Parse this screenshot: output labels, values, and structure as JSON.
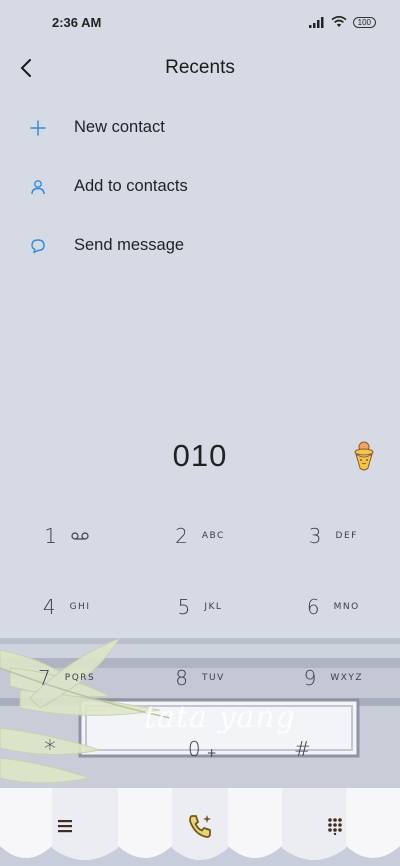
{
  "status": {
    "time": "2:36 AM",
    "battery": "100",
    "icons": [
      "signal-icon",
      "wifi-icon",
      "battery-icon"
    ]
  },
  "header": {
    "title": "Recents",
    "back_icon": "chevron-left-icon"
  },
  "actions": [
    {
      "label": "New contact",
      "icon": "plus-icon"
    },
    {
      "label": "Add to contacts",
      "icon": "person-icon"
    },
    {
      "label": "Send message",
      "icon": "chat-bubble-icon"
    }
  ],
  "dialer": {
    "number": "010",
    "sticker": "ice-cream-sticker"
  },
  "keypad": [
    [
      {
        "digit": "1",
        "letters": "voicemail"
      },
      {
        "digit": "2",
        "letters": "ABC"
      },
      {
        "digit": "3",
        "letters": "DEF"
      }
    ],
    [
      {
        "digit": "4",
        "letters": "GHI"
      },
      {
        "digit": "5",
        "letters": "JKL"
      },
      {
        "digit": "6",
        "letters": "MNO"
      }
    ],
    [
      {
        "digit": "7",
        "letters": "PQRS"
      },
      {
        "digit": "8",
        "letters": "TUV"
      },
      {
        "digit": "9",
        "letters": "WXYZ"
      }
    ],
    [
      {
        "digit": "*",
        "letters": ""
      },
      {
        "digit": "0",
        "letters": "+"
      },
      {
        "digit": "#",
        "letters": ""
      }
    ]
  ],
  "theme_text": "tata yang",
  "bottom_bar": {
    "menu_icon": "menu-icon",
    "call_icon": "phone-call-icon",
    "dialpad_icon": "dialpad-icon"
  },
  "colors": {
    "background": "#d6dae4",
    "accent": "#2f8ddf",
    "call": "#6e5a16"
  }
}
